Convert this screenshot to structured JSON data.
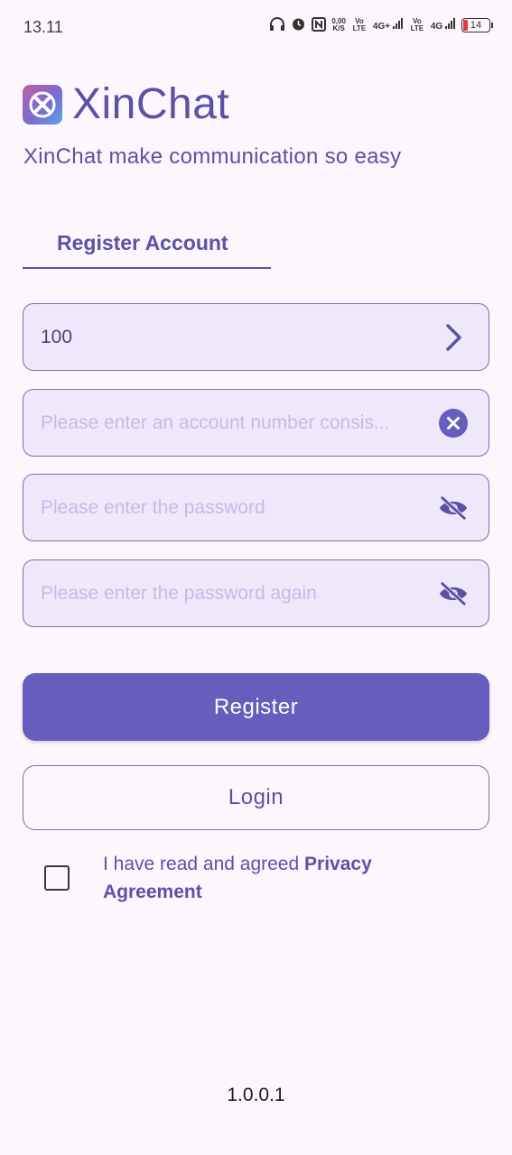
{
  "status_bar": {
    "time": "13.11",
    "net_speed": "0,00",
    "net_speed_unit": "K/S",
    "volte1": "Vo LTE",
    "network1": "4G+",
    "volte2": "Vo LTE",
    "network2": "4G",
    "battery": "14"
  },
  "header": {
    "app_name": "XinChat",
    "tagline": "XinChat make communication so easy"
  },
  "tab": {
    "label": "Register Account"
  },
  "form": {
    "country_code": {
      "value": "100"
    },
    "account": {
      "placeholder": "Please enter an account number consis..."
    },
    "password": {
      "placeholder": "Please enter the password"
    },
    "password_confirm": {
      "placeholder": "Please enter the password again"
    }
  },
  "buttons": {
    "register": "Register",
    "login": "Login"
  },
  "agreement": {
    "text": "I have read and agreed ",
    "link": "Privacy Agreement",
    "checked": false
  },
  "footer": {
    "version": "1.0.0.1"
  },
  "colors": {
    "accent": "#685dbd",
    "text": "#5b51a6",
    "field_bg": "#efe8fb",
    "background": "#fdf7fd"
  }
}
